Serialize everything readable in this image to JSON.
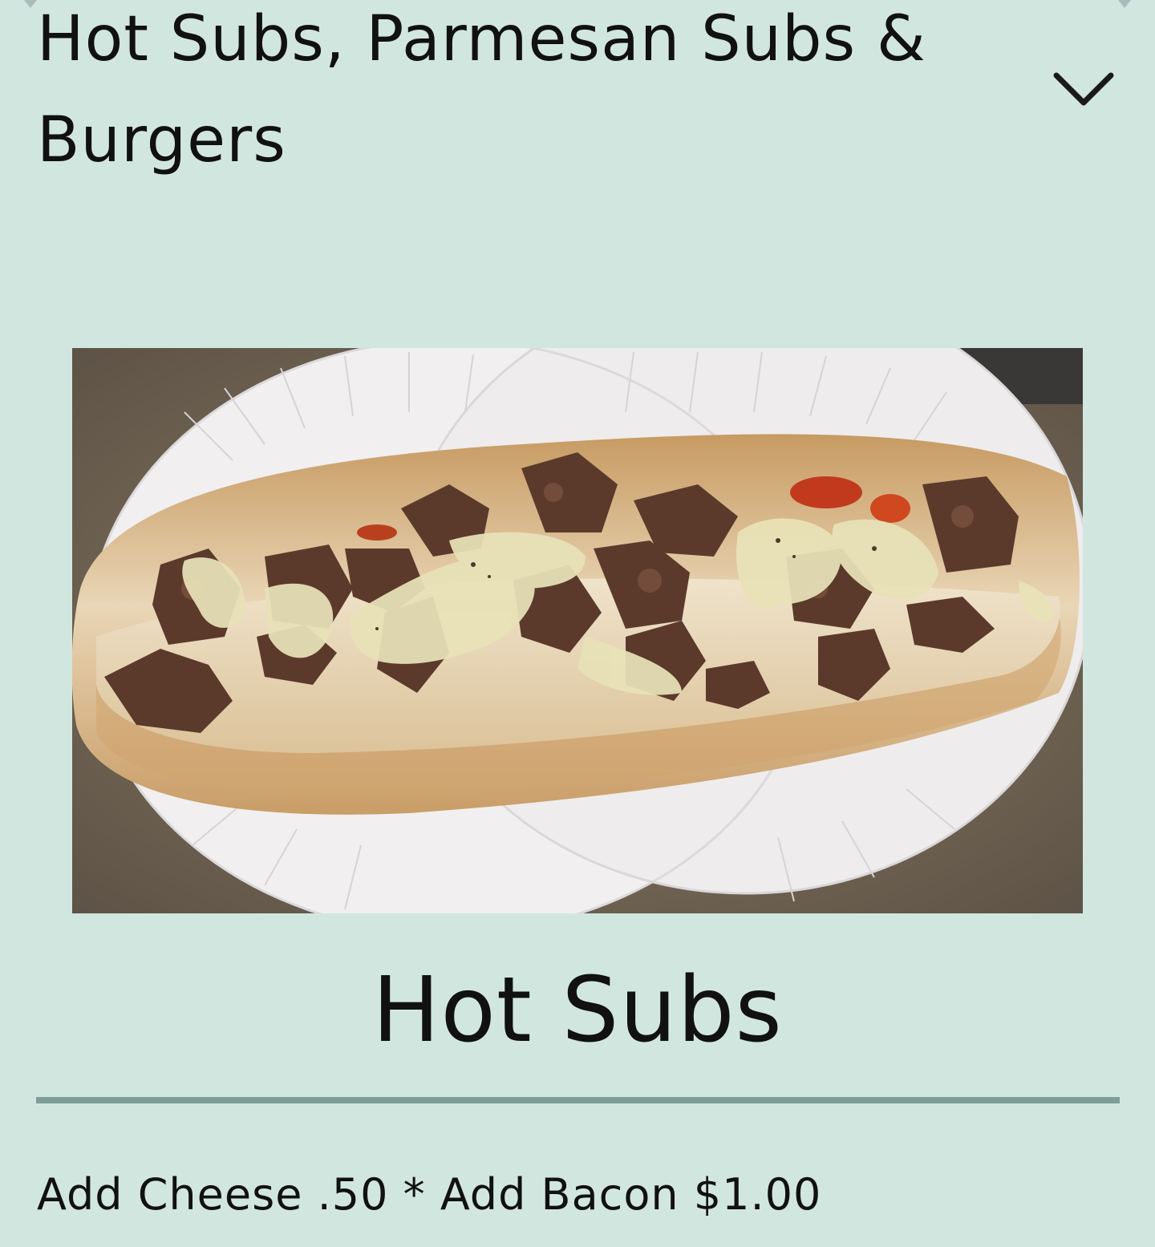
{
  "section": {
    "title": "Hot Subs, Parmesan Subs & Burgers",
    "toggle_icon": "chevron-down-icon"
  },
  "item": {
    "image_alt": "Steak and cheese hot sub on a paper plate",
    "title": "Hot Subs",
    "note": "Add Cheese .50 * Add Bacon $1.00"
  },
  "colors": {
    "background": "#d2e6e0",
    "divider": "#7f9d98",
    "text": "#111111"
  }
}
